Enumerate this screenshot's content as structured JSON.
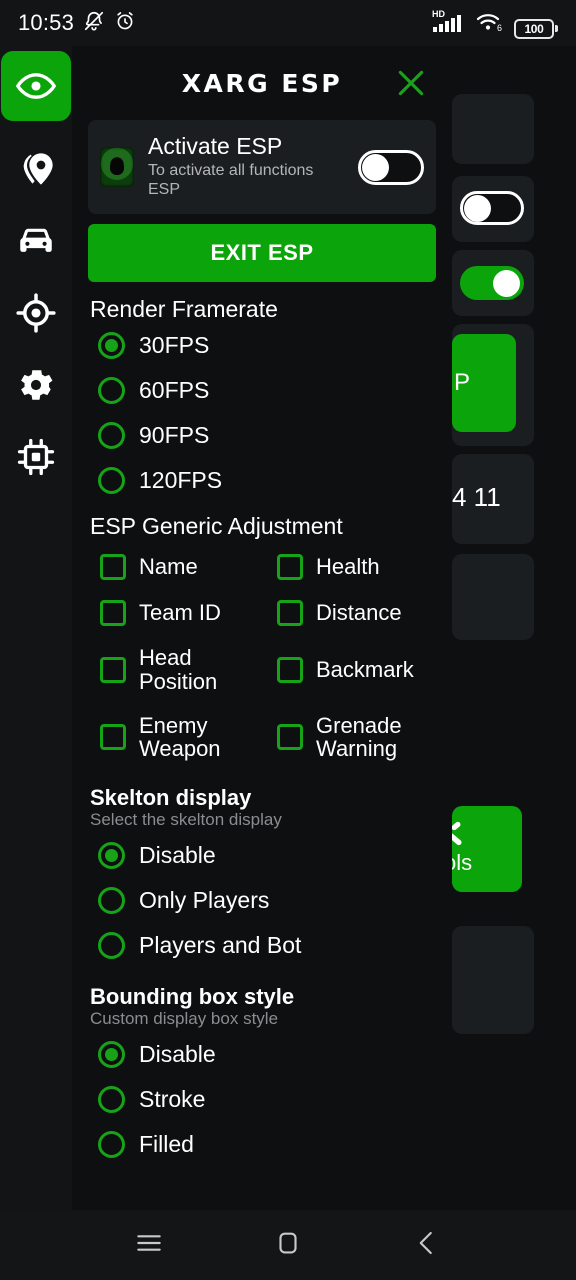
{
  "status_bar": {
    "time": "10:53",
    "icons_left": [
      "mute-bell-icon",
      "alarm-icon"
    ],
    "icons_right": [
      "hd-signal-icon",
      "wifi6-icon",
      "battery-icon"
    ],
    "network_label": "HD",
    "wifi_label": "6",
    "battery_level": "100"
  },
  "rail": {
    "items": [
      {
        "name": "esp-eye",
        "icon": "eye-icon",
        "active": true
      },
      {
        "name": "location",
        "icon": "map-pin-icon",
        "active": false
      },
      {
        "name": "vehicle",
        "icon": "car-icon",
        "active": false
      },
      {
        "name": "aimbot",
        "icon": "crosshair-target-icon",
        "active": false
      },
      {
        "name": "settings",
        "icon": "gear-icon",
        "active": false
      },
      {
        "name": "memory",
        "icon": "cpu-chip-icon",
        "active": false
      }
    ]
  },
  "panel": {
    "title": "XARG ESP",
    "close_icon": "close-x-icon",
    "activate_card": {
      "logo_icon": "esp-skull-logo-icon",
      "title": "Activate ESP",
      "subtitle": "To activate all functions ESP",
      "toggle_state": "off"
    },
    "exit_button": "EXIT ESP",
    "render_framerate": {
      "title": "Render Framerate",
      "options": [
        {
          "label": "30FPS",
          "selected": true
        },
        {
          "label": "60FPS",
          "selected": false
        },
        {
          "label": "90FPS",
          "selected": false
        },
        {
          "label": "120FPS",
          "selected": false
        }
      ]
    },
    "esp_generic_adjustment": {
      "title": "ESP Generic Adjustment",
      "options": [
        {
          "label": "Name",
          "checked": false
        },
        {
          "label": "Health",
          "checked": false
        },
        {
          "label": "Team ID",
          "checked": false
        },
        {
          "label": "Distance",
          "checked": false
        },
        {
          "label": "Head Position",
          "checked": false
        },
        {
          "label": "Backmark",
          "checked": false
        },
        {
          "label": "Enemy Weapon",
          "checked": false
        },
        {
          "label": "Grenade Warning",
          "checked": false
        }
      ]
    },
    "skelton_display": {
      "title": "Skelton display",
      "subtitle": "Select the skelton display",
      "options": [
        {
          "label": "Disable",
          "selected": true
        },
        {
          "label": "Only Players",
          "selected": false
        },
        {
          "label": "Players and Bot",
          "selected": false
        }
      ]
    },
    "bounding_box_style": {
      "title": "Bounding box style",
      "subtitle": "Custom display box style",
      "options": [
        {
          "label": "Disable",
          "selected": true
        },
        {
          "label": "Stroke",
          "selected": false
        },
        {
          "label": "Filled",
          "selected": false
        }
      ]
    }
  },
  "background_app": {
    "toggle_off_state": "off",
    "toggle_on_state": "on",
    "clipped_button_label": "P",
    "clipped_text": "4 11",
    "clipped_tools_label": "ols"
  },
  "nav_bar": {
    "items": [
      {
        "name": "recents",
        "icon": "hamburger-menu-icon"
      },
      {
        "name": "home",
        "icon": "rounded-square-icon"
      },
      {
        "name": "back",
        "icon": "chevron-left-icon"
      }
    ]
  },
  "colors": {
    "accent_green": "#0BA50B",
    "outline_green": "#17A317",
    "panel_bg": "#0D0F10",
    "card_bg": "#1B1E20",
    "text_primary": "#FFFFFF",
    "text_secondary": "#8A8D8F"
  }
}
